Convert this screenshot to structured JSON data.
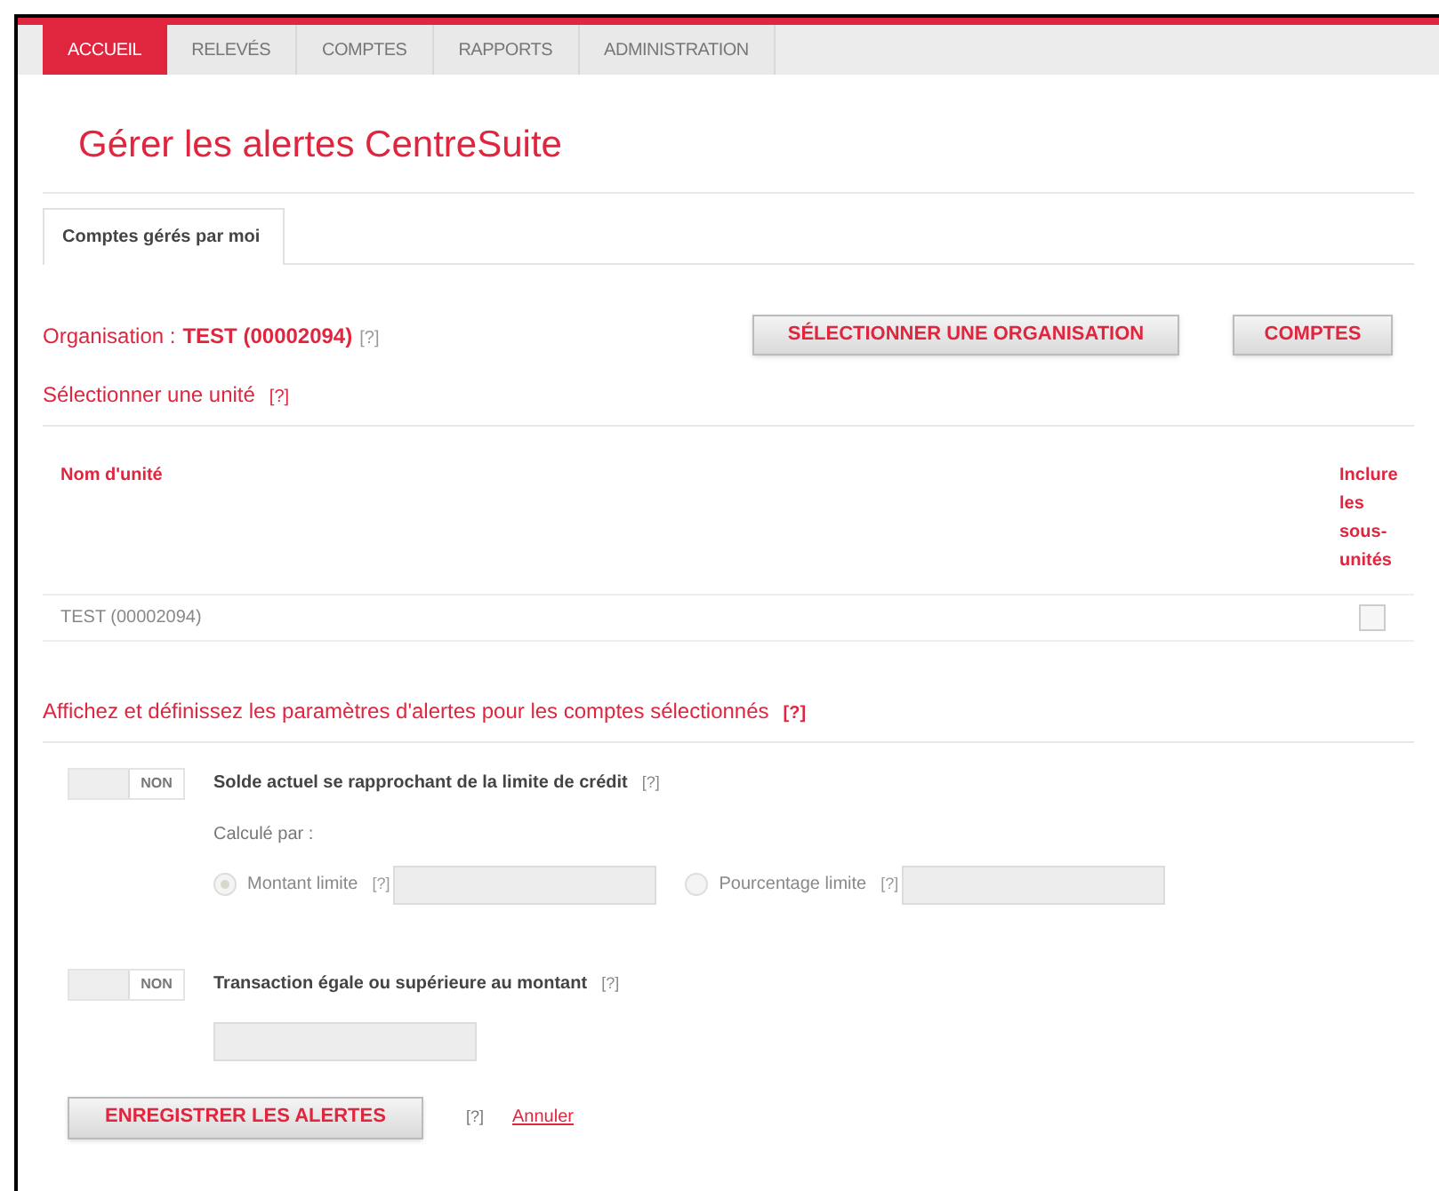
{
  "nav_tabs": [
    {
      "label": "ACCUEIL",
      "selected": true
    },
    {
      "label": "RELEVÉS",
      "selected": false
    },
    {
      "label": "COMPTES",
      "selected": false
    },
    {
      "label": "RAPPORTS",
      "selected": false
    },
    {
      "label": "ADMINISTRATION",
      "selected": false
    }
  ],
  "page_title": "Gérer les alertes CentreSuite",
  "sub_tabs": [
    {
      "label": "Comptes gérés par moi",
      "selected": true
    }
  ],
  "organisation": {
    "label": "Organisation :",
    "value": "TEST (00002094)",
    "help": "[?]"
  },
  "org_buttons": [
    "SÉLECTIONNER UNE ORGANISATION",
    "COMPTES"
  ],
  "unit_section": {
    "title": "Sélectionner une unité",
    "help": "[?]"
  },
  "unit_table": {
    "columns": [
      "Nom d'unité",
      "Inclure les sous-unités"
    ],
    "rows": [
      {
        "name": "TEST (00002094)",
        "checked": false
      }
    ]
  },
  "alerts_section": {
    "title": "Affichez et définissez les paramètres d'alertes pour les comptes sélectionnés",
    "help": "[?]"
  },
  "alerts": [
    {
      "toggle_label": "NON",
      "on": false,
      "title": "Solde actuel se rapprochant de la limite de crédit",
      "help": "[?]",
      "calc_label": "Calculé par :",
      "options": [
        {
          "label": "Montant limite",
          "help": "[?]",
          "selected": true
        },
        {
          "label": "Pourcentage limite",
          "help": "[?]",
          "selected": false
        }
      ]
    },
    {
      "toggle_label": "NON",
      "on": false,
      "title": "Transaction égale ou supérieure au montant",
      "help": "[?]"
    }
  ],
  "footer": {
    "save": "ENREGISTRER LES ALERTES",
    "help": "[?]",
    "cancel": "Annuler"
  }
}
